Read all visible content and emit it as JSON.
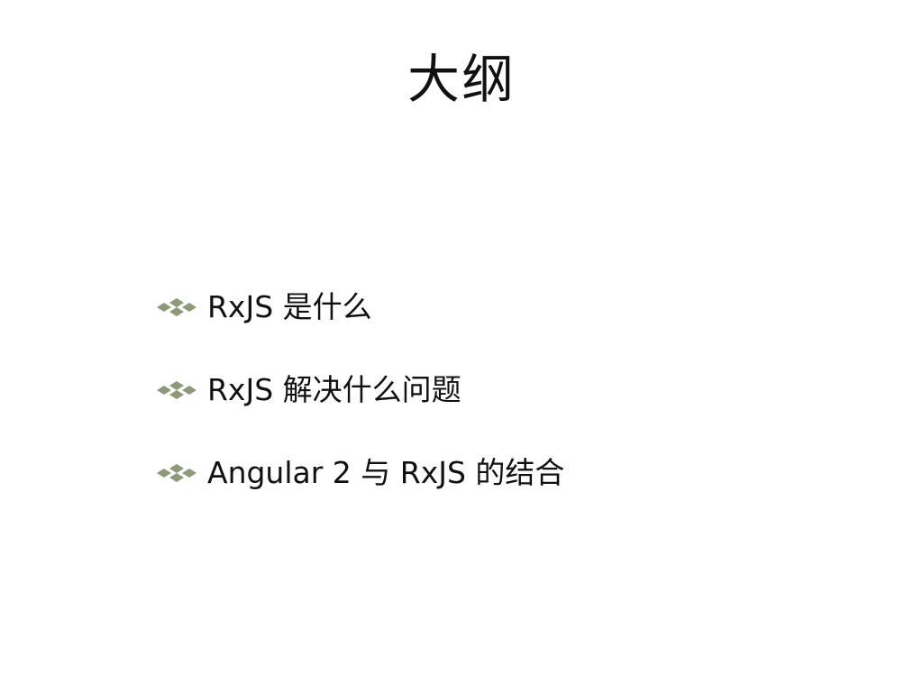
{
  "slide": {
    "title": "大纲",
    "bullet_icon": "diamond-cluster-icon",
    "bullet_color": "#8c9a78",
    "bullets": [
      {
        "text": "RxJS 是什么"
      },
      {
        "text": "RxJS 解决什么问题"
      },
      {
        "text": "Angular 2 与 RxJS 的结合"
      }
    ]
  }
}
